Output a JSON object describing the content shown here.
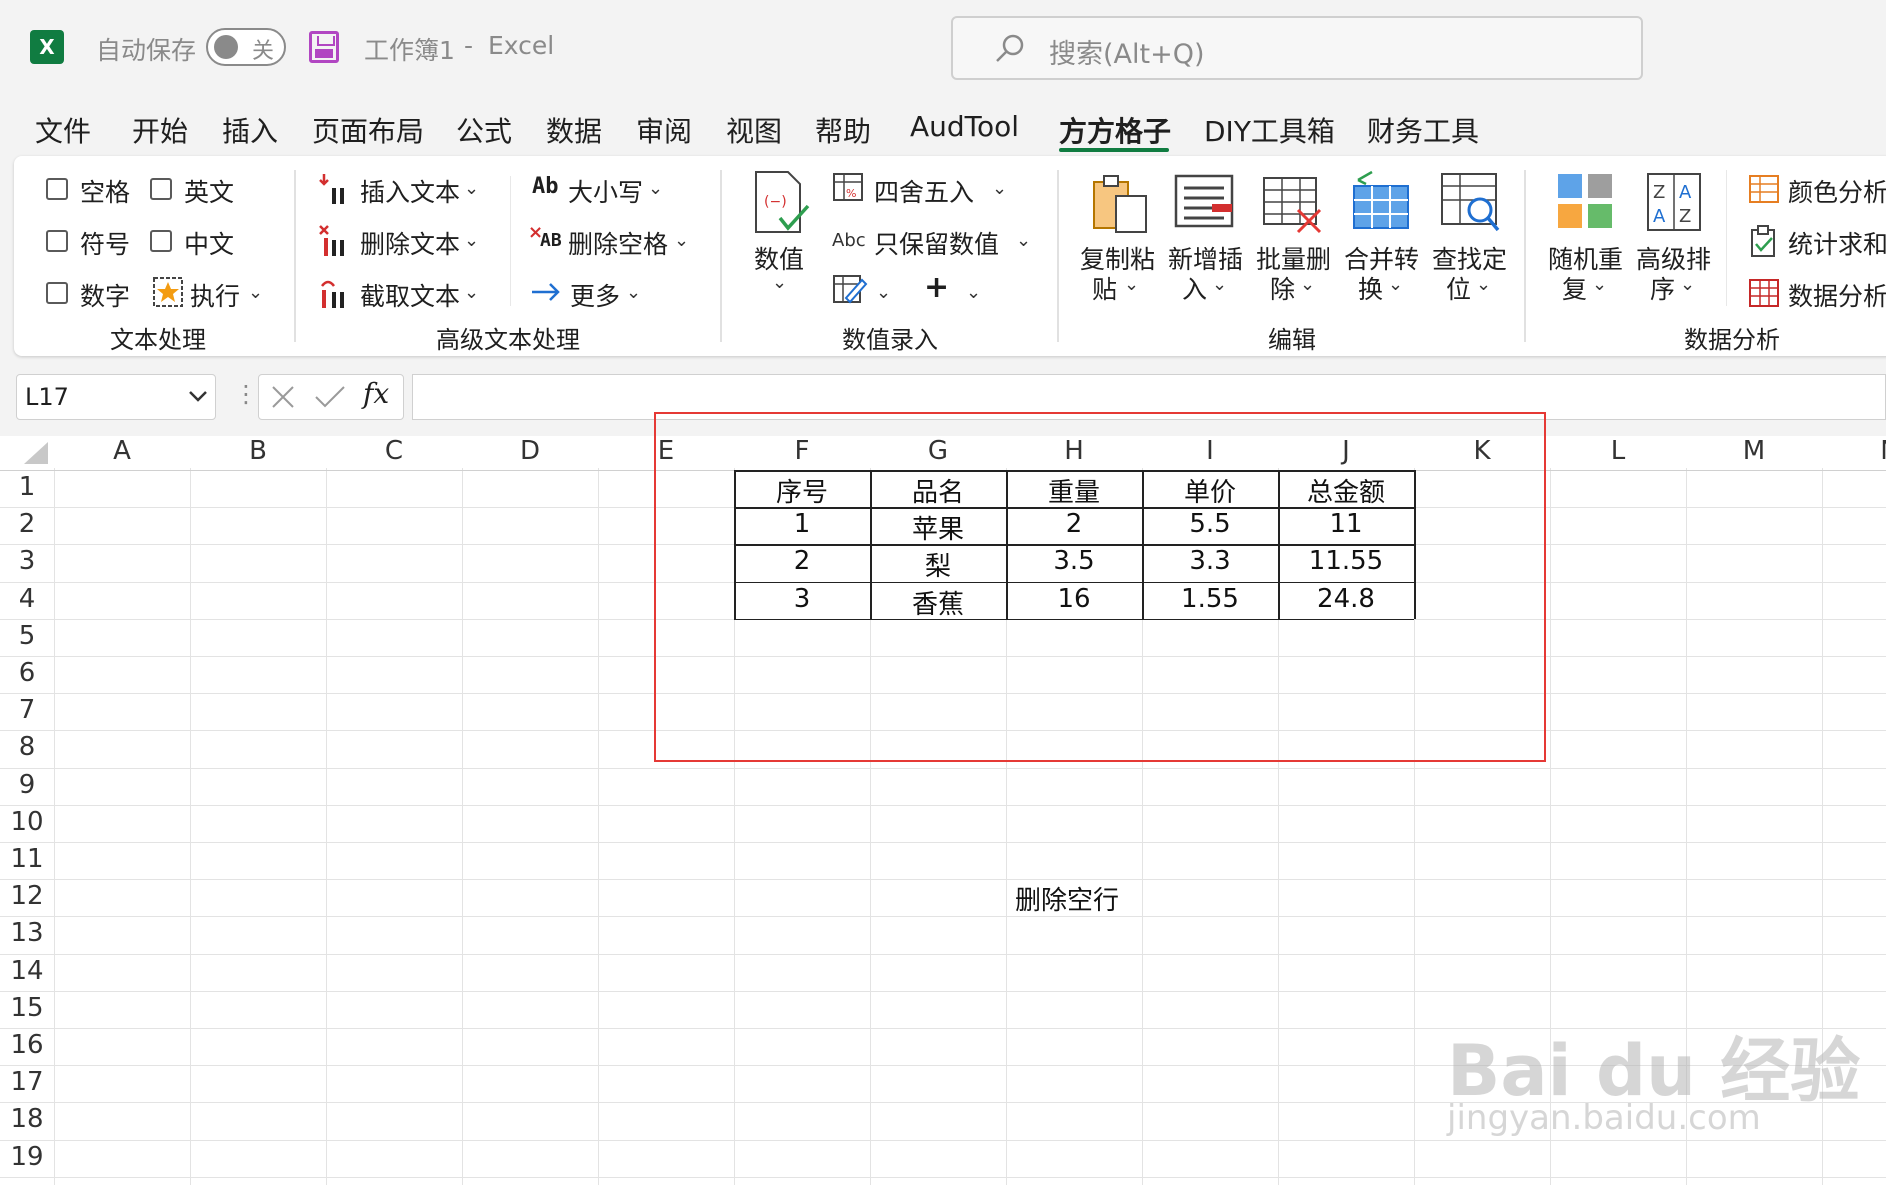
{
  "titlebar": {
    "app_icon": "X",
    "autosave_label": "自动保存",
    "autosave_state": "关",
    "workbook": "工作簿1",
    "separator": "-",
    "app_name": "Excel",
    "search_placeholder": "搜索(Alt+Q)"
  },
  "tabs": [
    "文件",
    "开始",
    "插入",
    "页面布局",
    "公式",
    "数据",
    "审阅",
    "视图",
    "帮助",
    "AudTool",
    "方方格子",
    "DIY工具箱",
    "财务工具"
  ],
  "ribbon": {
    "text_processing": {
      "checkboxes": [
        "空格",
        "英文",
        "符号",
        "中文",
        "数字"
      ],
      "execute": "执行",
      "label": "文本处理"
    },
    "advanced_text": {
      "insert": "插入文本",
      "delete": "删除文本",
      "cut": "截取文本",
      "case": "大小写",
      "case_icon": "Ab",
      "delete_space": "删除空格",
      "delete_space_icon": "AB",
      "more": "更多",
      "label": "高级文本处理"
    },
    "numeric_entry": {
      "value": "数值",
      "round": "四舍五入",
      "keep_numbers": "只保留数值",
      "keep_icon": "Abc",
      "plus": "+",
      "label": "数值录入"
    },
    "edit": {
      "copy_paste": [
        "复制粘",
        "贴"
      ],
      "new_insert": [
        "新增插",
        "入"
      ],
      "batch_delete": [
        "批量删",
        "除"
      ],
      "merge_convert": [
        "合并转",
        "换"
      ],
      "find_locate": [
        "查找定",
        "位"
      ],
      "label": "编辑"
    },
    "data_analysis": {
      "random_repeat": [
        "随机重",
        "复"
      ],
      "advanced_sort": [
        "高级排",
        "序"
      ],
      "color_analysis": "颜色分析",
      "stat_sum": "统计求和",
      "data_analysis": "数据分析",
      "label": "数据分析"
    }
  },
  "formula_bar": {
    "name_box": "L17",
    "fx": "fx",
    "formula": ""
  },
  "sheet": {
    "columns": [
      "A",
      "B",
      "C",
      "D",
      "E",
      "F",
      "G",
      "H",
      "I",
      "J",
      "K",
      "L",
      "M",
      "N"
    ],
    "rows": [
      "1",
      "2",
      "3",
      "4",
      "5",
      "6",
      "7",
      "8",
      "9",
      "10",
      "11",
      "12",
      "13",
      "14",
      "15",
      "16",
      "17",
      "18",
      "19"
    ],
    "table_headers": [
      "序号",
      "品名",
      "重量",
      "单价",
      "总金额"
    ],
    "table_rows": [
      [
        "1",
        "苹果",
        "2",
        "5.5",
        "11"
      ],
      [
        "2",
        "梨",
        "3.5",
        "3.3",
        "11.55"
      ],
      [
        "3",
        "香蕉",
        "16",
        "1.55",
        "24.8"
      ]
    ],
    "note": "删除空行"
  },
  "watermark": {
    "line1": "Bai du 经验",
    "line2": "jingyan.baidu.com"
  },
  "colors": {
    "excel_green": "#107c41",
    "highlight_red": "#e53935",
    "save_purple": "#b146c2"
  }
}
